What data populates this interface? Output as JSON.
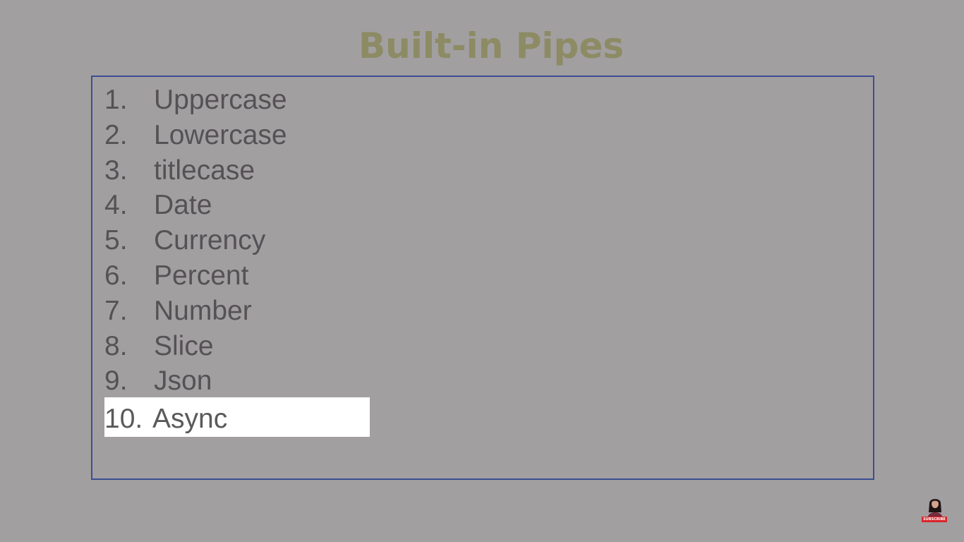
{
  "slide": {
    "title": "Built-in Pipes",
    "items": [
      {
        "number": "1.",
        "label": "Uppercase"
      },
      {
        "number": "2.",
        "label": "Lowercase"
      },
      {
        "number": "3.",
        "label": "titlecase"
      },
      {
        "number": "4.",
        "label": "Date"
      },
      {
        "number": "5.",
        "label": "Currency"
      },
      {
        "number": "6.",
        "label": "Percent"
      },
      {
        "number": "7.",
        "label": "Number"
      },
      {
        "number": "8.",
        "label": "Slice"
      },
      {
        "number": "9.",
        "label": "Json"
      },
      {
        "number": "10.",
        "label": "Async"
      }
    ],
    "highlighted_item": "10. Async"
  },
  "overlay": {
    "subscribe_label": "SUBSCRIBE",
    "avatar_icon": "presenter-avatar-icon"
  },
  "colors": {
    "background": "#a29fa1",
    "title": "#8c8b64",
    "border": "#3d4d90",
    "text": "#555256",
    "highlight": "#ffffff",
    "subscribe": "#d8252a"
  }
}
